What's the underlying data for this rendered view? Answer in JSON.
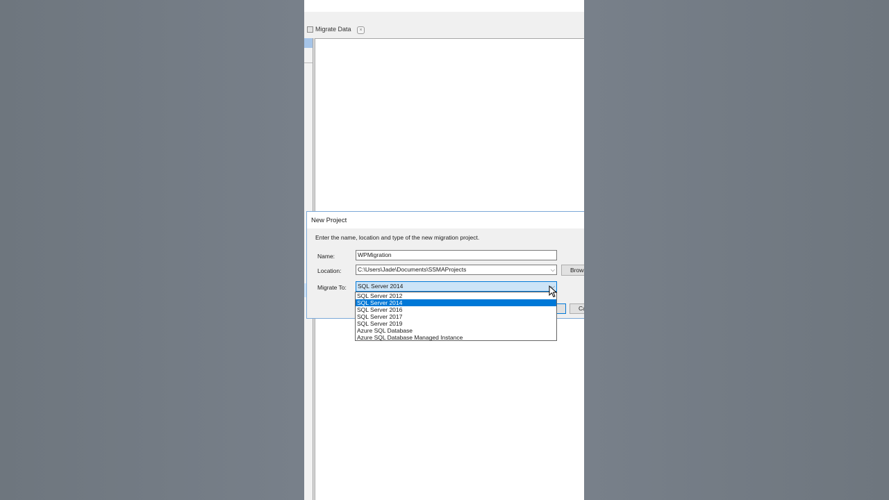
{
  "tabs": {
    "migrate_data": "Migrate Data"
  },
  "dialog": {
    "title": "New Project",
    "description": "Enter the name, location and type of the new migration project.",
    "name_label": "Name:",
    "name_value": "WPMigration",
    "location_label": "Location:",
    "location_value": "C:\\Users\\Jade\\Documents\\SSMAProjects",
    "migrate_to_label": "Migrate To:",
    "migrate_to_value": "SQL Server 2014",
    "browse_label": "Brows",
    "cancel_label": "Ca"
  },
  "dropdown": {
    "options": [
      "SQL Server 2012",
      "SQL Server 2014",
      "SQL Server 2016",
      "SQL Server 2017",
      "SQL Server 2019",
      "Azure SQL Database",
      "Azure SQL Database Managed Instance"
    ],
    "selected": "SQL Server 2014"
  },
  "colors": {
    "selection": "#0078d7",
    "combo_open_bg": "#cce4f7",
    "dialog_border": "#7aa8d8",
    "background": "#727a82"
  },
  "icons": [
    "migrate-data-tab-icon",
    "tab-close-icon",
    "combo-chevron-down-icon",
    "mouse-pointer-icon"
  ]
}
